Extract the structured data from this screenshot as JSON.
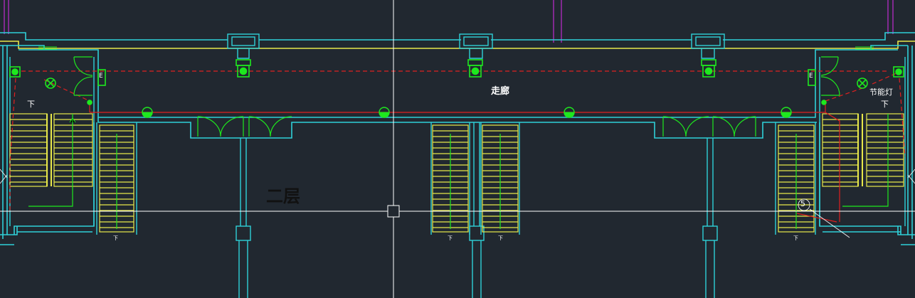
{
  "colors": {
    "background": "#212830",
    "wall": "#2fd0d8",
    "stair": "#e8e84a",
    "circuit": "#e02020",
    "fixture": "#1ee81e",
    "door": "#1ee81e",
    "column_grid": "#a02ab0",
    "crosshair": "#ffffff",
    "text": "#ffffff"
  },
  "labels": {
    "corridor": "走廊",
    "floor": "二层",
    "energy_lamp": "节能灯",
    "down_left": "下",
    "down_right": "下",
    "stair_down": "下",
    "axis_number": "5",
    "exit_mark": "E"
  },
  "cursor": {
    "type": "crosshair-with-pickbox"
  }
}
